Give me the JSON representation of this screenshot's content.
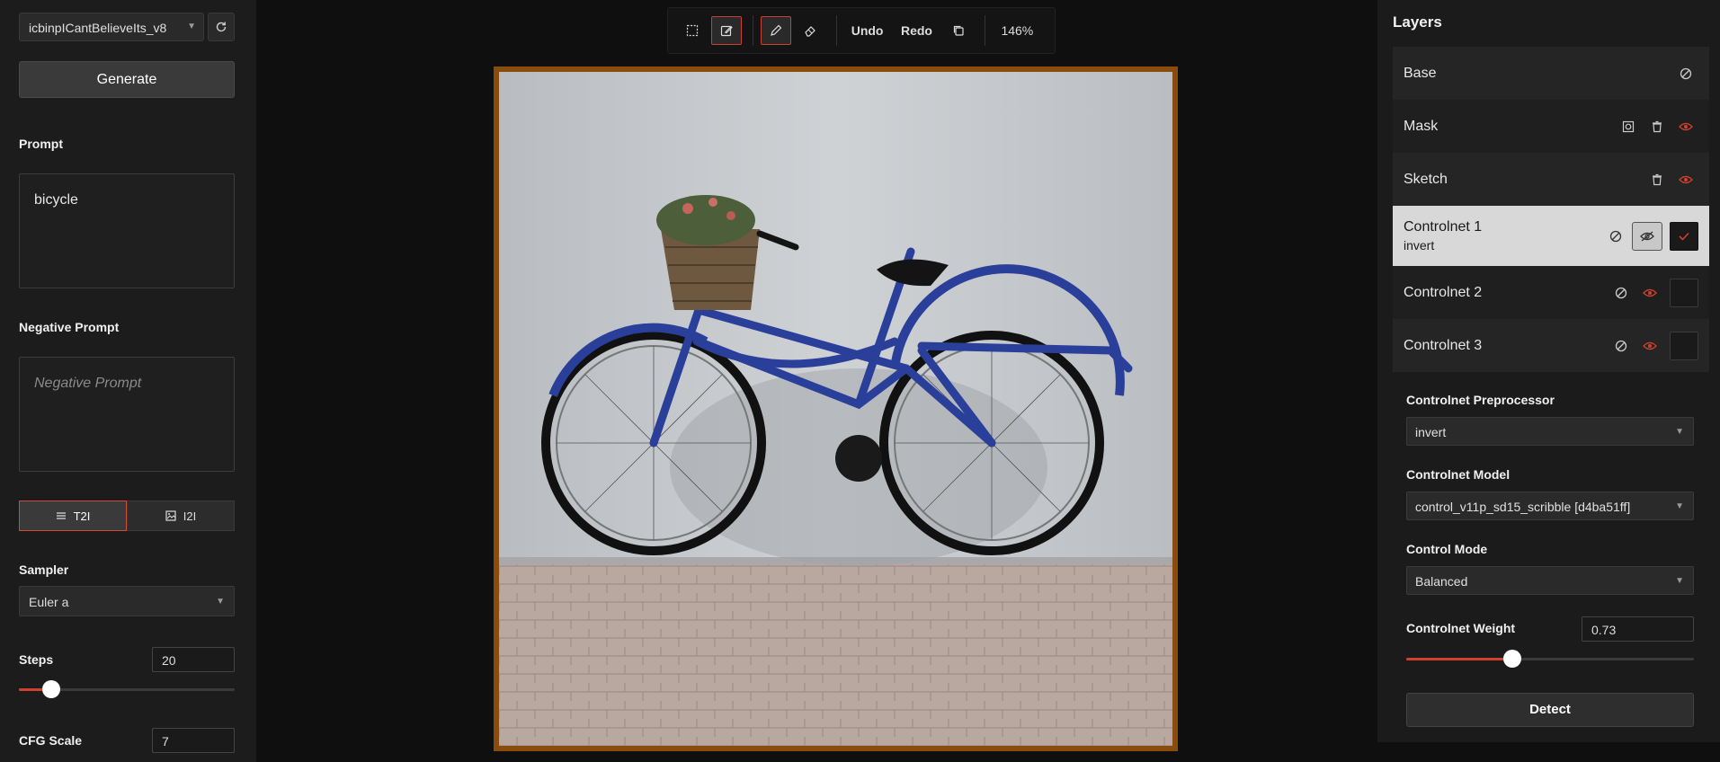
{
  "left": {
    "model": "icbinpICantBelieveIts_v8",
    "generate_label": "Generate",
    "prompt_label": "Prompt",
    "prompt_value": "bicycle",
    "negative_label": "Negative Prompt",
    "negative_placeholder": "Negative Prompt",
    "modes": [
      {
        "label": "T2I",
        "icon": "list-icon",
        "active": true
      },
      {
        "label": "I2I",
        "icon": "image-icon",
        "active": false
      }
    ],
    "sampler_label": "Sampler",
    "sampler_value": "Euler a",
    "steps_label": "Steps",
    "steps_value": "20",
    "steps_fraction": 0.15,
    "cfg_label": "CFG Scale",
    "cfg_value": "7"
  },
  "toolbar": {
    "undo": "Undo",
    "redo": "Redo",
    "zoom": "146%"
  },
  "right": {
    "title": "Layers",
    "layers": [
      {
        "name": "Base",
        "sub": ""
      },
      {
        "name": "Mask",
        "sub": ""
      },
      {
        "name": "Sketch",
        "sub": ""
      },
      {
        "name": "Controlnet 1",
        "sub": "invert",
        "selected": true
      },
      {
        "name": "Controlnet 2",
        "sub": ""
      },
      {
        "name": "Controlnet 3",
        "sub": ""
      }
    ],
    "preprocessor_label": "Controlnet Preprocessor",
    "preprocessor_value": "invert",
    "model_label": "Controlnet Model",
    "model_value": "control_v11p_sd15_scribble [d4ba51ff]",
    "mode_label": "Control Mode",
    "mode_value": "Balanced",
    "weight_label": "Controlnet Weight",
    "weight_value": "0.73",
    "weight_fraction": 0.37,
    "detect_label": "Detect"
  },
  "colors": {
    "accent": "#d0402f",
    "canvas_border": "#8a4c0c"
  }
}
